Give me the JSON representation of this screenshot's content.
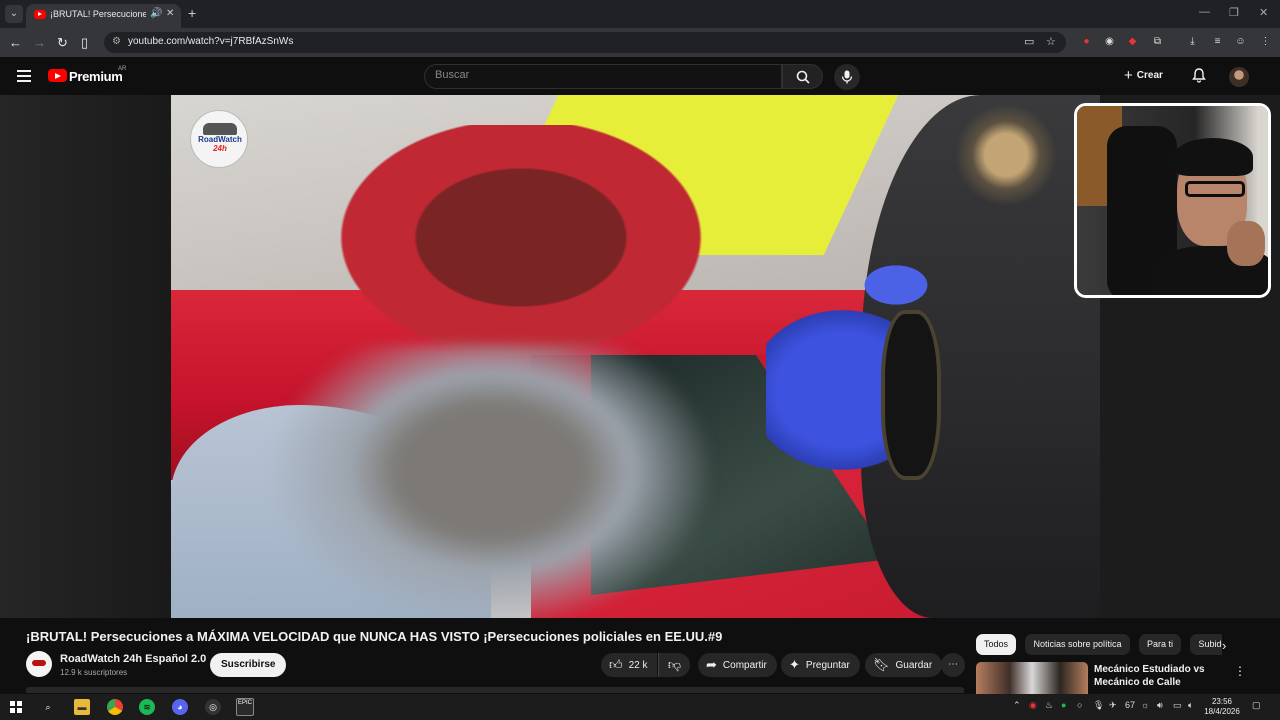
{
  "browser": {
    "tab_title": "¡BRUTAL! Persecuciones a MÁXIMA VELOCIDAD que NUNCA HAS VISTO",
    "url": "youtube.com/watch?v=j7RBfAzSnWs"
  },
  "header": {
    "brand": "Premium",
    "country": "AR",
    "search_placeholder": "Buscar",
    "create_label": "Crear"
  },
  "video": {
    "overlay_logo_line1": "RoadWatch",
    "overlay_logo_line2": "24h",
    "title": "¡BRUTAL! Persecuciones a MÁXIMA VELOCIDAD que NUNCA HAS VISTO ¡Persecuciones policiales en EE.UU.#9"
  },
  "channel": {
    "name": "RoadWatch 24h Español 2.0",
    "subscribers": "12.9 k suscriptores",
    "subscribe_label": "Suscribirse"
  },
  "actions": {
    "likes": "22 k",
    "share": "Compartir",
    "ask": "Preguntar",
    "save": "Guardar"
  },
  "chips": [
    "Todos",
    "Noticias sobre política",
    "Para ti",
    "Subidos recientemente"
  ],
  "recommendation": {
    "title": "Mecánico Estudiado vs Mecánico de Calle"
  },
  "taskbar": {
    "temp": "67",
    "time": "23:56",
    "date": "18/4/2026"
  },
  "colors": {
    "accent_red": "#ff0000",
    "background": "#0f0f0f",
    "chip_bg": "#272727"
  }
}
